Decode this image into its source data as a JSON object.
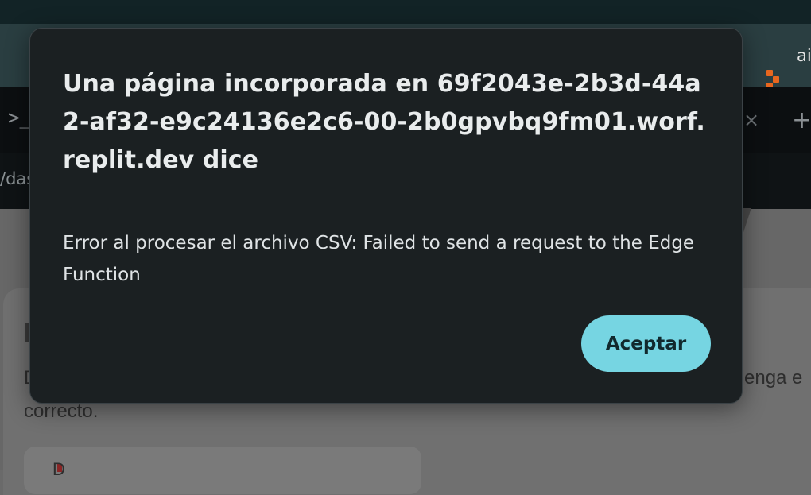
{
  "background": {
    "extension_label": "ai",
    "url_fragment": "/das",
    "terminal_prompt": ">_",
    "close_glyph": "×",
    "plus_glyph": "+",
    "page_text_left": "D",
    "page_text_right": "enga e",
    "page_text_line2": "correcto.",
    "inner_card_text": "D"
  },
  "dialog": {
    "title": "Una página incorporada en 69f2043e-2b3d-44a2-af32-e9c24136e2c6-00-2b0gpvbq9fm01.worf.replit.dev dice",
    "message": "Error al procesar el archivo CSV: Failed to send a request to the Edge Function",
    "accept_label": "Aceptar"
  },
  "colors": {
    "dialog_bg": "#1b2022",
    "accent": "#76d5e2",
    "extension_icon": "#e8671f"
  }
}
